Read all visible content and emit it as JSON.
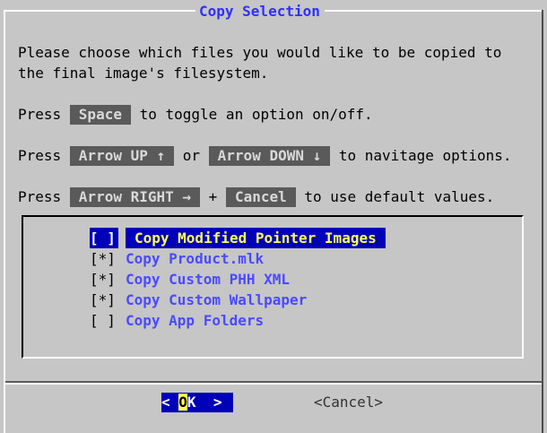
{
  "dialog": {
    "title": "Copy Selection",
    "intro_line1": "Please choose which files you would like to be copied to",
    "intro_line2": "the final image's filesystem.",
    "help": {
      "line1": {
        "prefix": "Press ",
        "key": "Space",
        "suffix": " to toggle an option on/off."
      },
      "line2": {
        "prefix": "Press ",
        "key1": "Arrow UP ↑",
        "middle": " or ",
        "key2": "Arrow DOWN ↓",
        "suffix": " to navitage options."
      },
      "line3": {
        "prefix": "Press ",
        "key1": "Arrow RIGHT →",
        "middle": " + ",
        "key2": "Cancel",
        "suffix": " to use default values."
      }
    }
  },
  "checklist": {
    "items": [
      {
        "mark": "[ ]",
        "label": "Copy Modified Pointer Images",
        "checked": false,
        "selected": true
      },
      {
        "mark": "[*]",
        "label": "Copy Product.mlk",
        "checked": true,
        "selected": false
      },
      {
        "mark": "[*]",
        "label": "Copy Custom PHH XML",
        "checked": true,
        "selected": false
      },
      {
        "mark": "[*]",
        "label": "Copy Custom Wallpaper",
        "checked": true,
        "selected": false
      },
      {
        "mark": "[ ]",
        "label": "Copy App Folders",
        "checked": false,
        "selected": false
      }
    ]
  },
  "buttons": {
    "ok": {
      "open": "< ",
      "hotkey": "O",
      "rest": "K",
      "close": "  >"
    },
    "cancel": "<Cancel>"
  },
  "colors": {
    "background": "#c6c6c6",
    "title": "#2f2fff",
    "item_label": "#4a4aff",
    "selection_bg": "#0000b8",
    "selection_fg": "#ffff55",
    "key_bg": "#5a5a5a"
  }
}
